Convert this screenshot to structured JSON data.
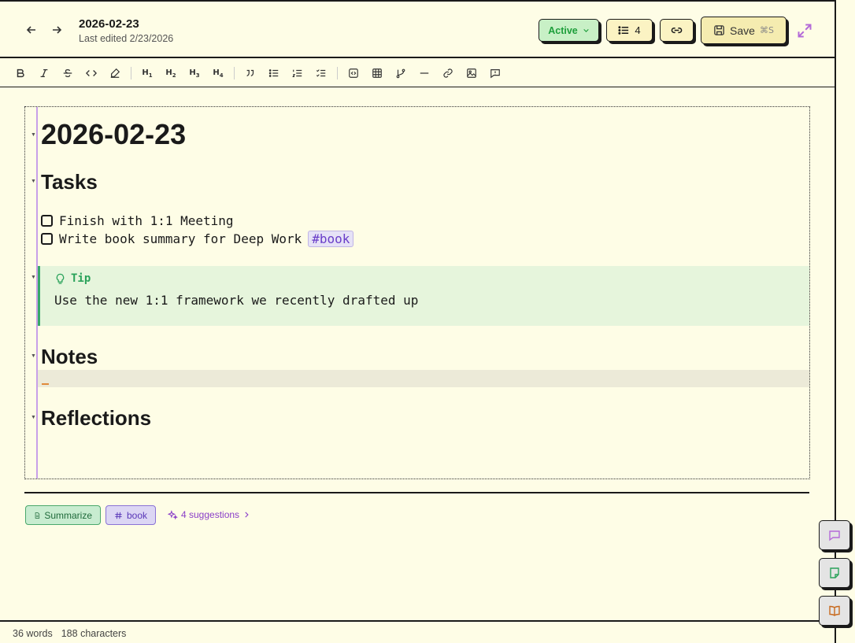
{
  "header": {
    "title": "2026-02-23",
    "subtitle": "Last edited 2/23/2026",
    "status_label": "Active",
    "outline_count": "4",
    "save_label": "Save",
    "save_shortcut": "⌘S"
  },
  "toolbar": {
    "h1": "H",
    "h1n": "1",
    "h2": "H",
    "h2n": "2",
    "h3": "H",
    "h3n": "3",
    "h4": "H",
    "h4n": "4"
  },
  "document": {
    "heading": "2026-02-23",
    "tasks_heading": "Tasks",
    "tasks": [
      {
        "text": "Finish with 1:1 Meeting",
        "tag": ""
      },
      {
        "text": "Write book summary for Deep Work",
        "tag": "#book"
      }
    ],
    "callout_title": "Tip",
    "callout_body": "Use the new 1:1 framework we recently drafted up",
    "notes_heading": "Notes",
    "reflections_heading": "Reflections"
  },
  "footer_chips": {
    "summarize": "Summarize",
    "book": "book",
    "suggestions": "4 suggestions"
  },
  "status": {
    "words": "36 words",
    "characters": "188 characters"
  },
  "colors": {
    "background": "#fefde6",
    "active": "#1d9e3a",
    "accent_purple": "#8a3ec8",
    "callout": "#e6f5dc"
  }
}
